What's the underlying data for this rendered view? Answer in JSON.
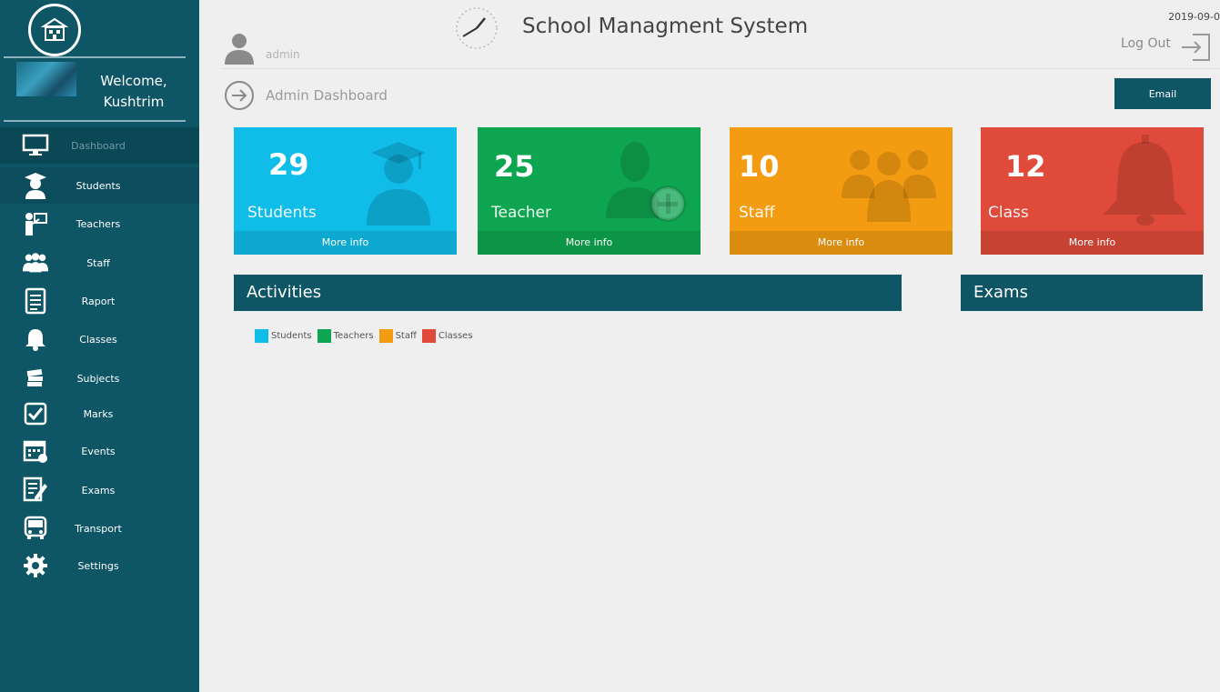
{
  "sidebar": {
    "welcome_line1": "Welcome,",
    "welcome_line2": "Kushtrim",
    "items": [
      {
        "label": "Dashboard",
        "icon": "monitor-icon"
      },
      {
        "label": "Students",
        "icon": "student-icon"
      },
      {
        "label": "Teachers",
        "icon": "teacher-icon"
      },
      {
        "label": "Staff",
        "icon": "staff-icon"
      },
      {
        "label": "Raport",
        "icon": "report-icon"
      },
      {
        "label": "Classes",
        "icon": "bell-icon"
      },
      {
        "label": "Subjects",
        "icon": "books-icon"
      },
      {
        "label": "Marks",
        "icon": "checkbox-icon"
      },
      {
        "label": "Events",
        "icon": "calendar-icon"
      },
      {
        "label": "Exams",
        "icon": "exam-icon"
      },
      {
        "label": "Transport",
        "icon": "bus-icon"
      },
      {
        "label": "Settings",
        "icon": "gear-icon"
      }
    ]
  },
  "header": {
    "user": "admin",
    "title": "School Managment System",
    "date": "2019-09-0",
    "logout": "Log Out"
  },
  "page": {
    "title": "Admin Dashboard",
    "email_button": "Email"
  },
  "cards": [
    {
      "value": "29",
      "label": "Students",
      "more": "More info",
      "color": "#10bde9",
      "icon": "graduate-icon"
    },
    {
      "value": "25",
      "label": "Teacher",
      "more": "More info",
      "color": "#0ea550",
      "icon": "add-user-icon"
    },
    {
      "value": "10",
      "label": "Staff",
      "more": "More info",
      "color": "#f39c11",
      "icon": "group-icon"
    },
    {
      "value": "12",
      "label": "Class",
      "more": "More info",
      "color": "#df4a3a",
      "icon": "bell-icon"
    }
  ],
  "panels": {
    "activities": "Activities",
    "exams": "Exams"
  },
  "legend": [
    {
      "label": "Students",
      "color": "#10bde9"
    },
    {
      "label": "Teachers",
      "color": "#0ea550"
    },
    {
      "label": "Staff",
      "color": "#f39c11"
    },
    {
      "label": "Classes",
      "color": "#df4a3a"
    }
  ],
  "colors": {
    "sidebar": "#0e5566",
    "accent": "#0e5566"
  }
}
